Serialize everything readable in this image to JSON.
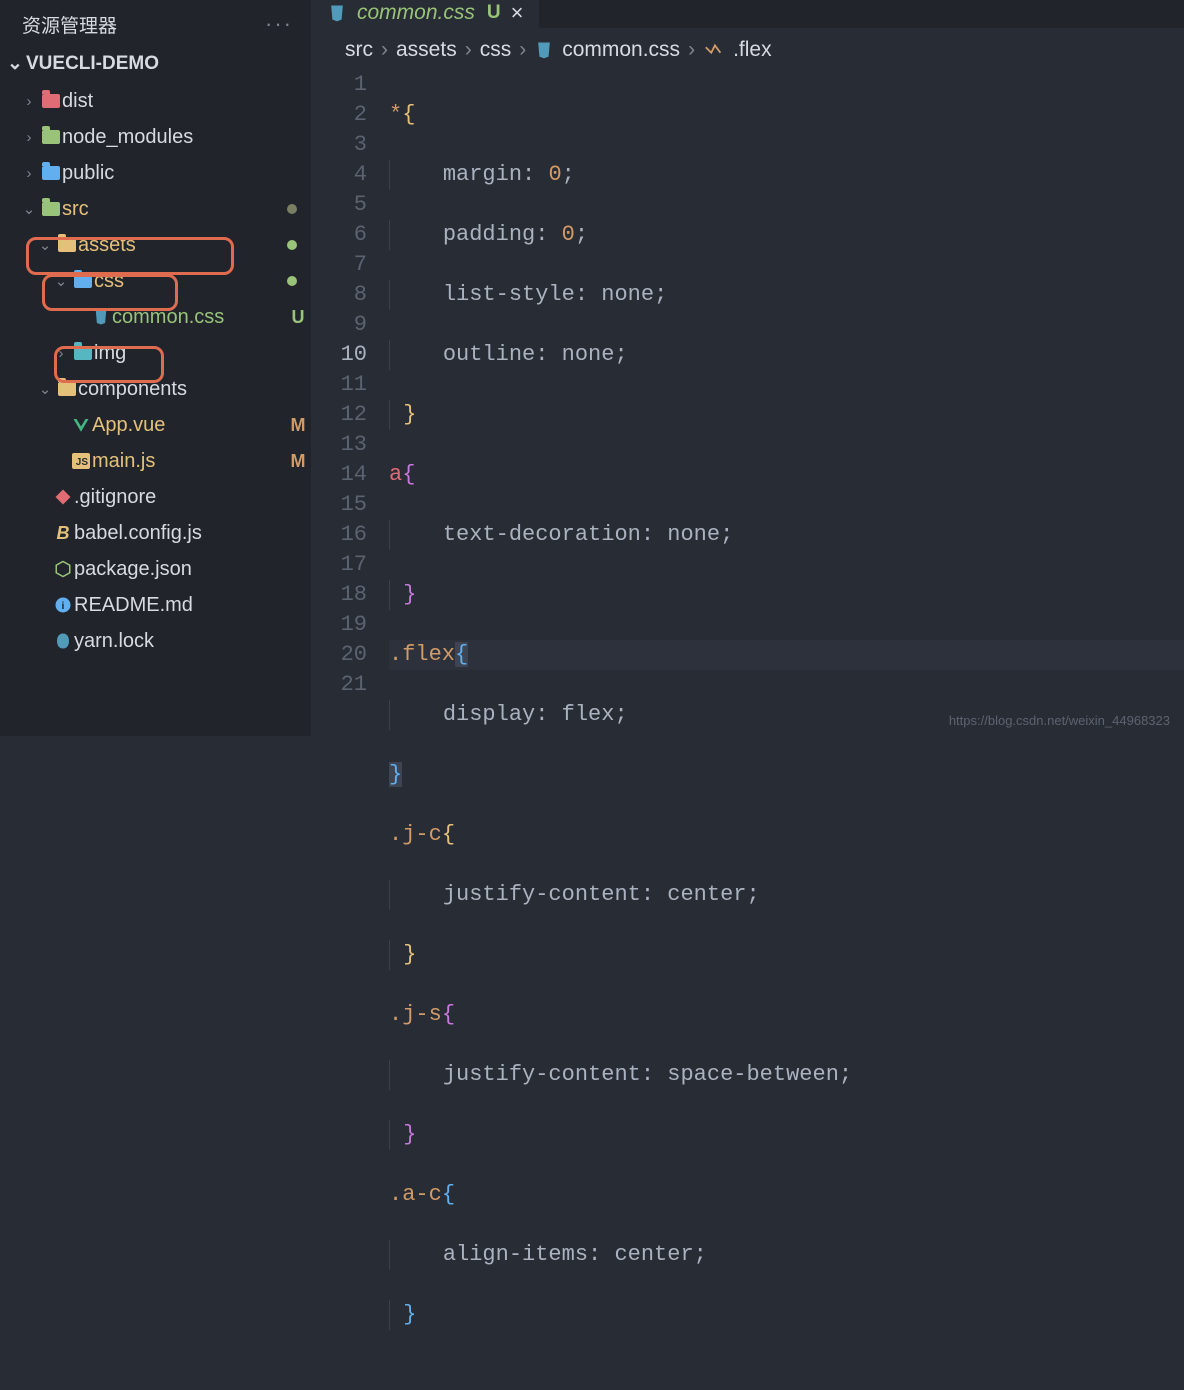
{
  "explorer": {
    "title": "资源管理器"
  },
  "project": {
    "name": "VUECLI-DEMO"
  },
  "tree": {
    "dist": "dist",
    "node_modules": "node_modules",
    "public": "public",
    "src": "src",
    "assets": "assets",
    "css": "css",
    "common_css": "common.css",
    "img": "img",
    "components": "components",
    "app_vue": "App.vue",
    "main_js": "main.js",
    "gitignore": ".gitignore",
    "babel": "babel.config.js",
    "package": "package.json",
    "readme": "README.md",
    "yarnlock": "yarn.lock"
  },
  "tab": {
    "name": "common.css",
    "status": "U"
  },
  "breadcrumbs": {
    "p1": "src",
    "p2": "assets",
    "p3": "css",
    "p4": "common.css",
    "p5": ".flex"
  },
  "code": {
    "l1a": "*",
    "l1b": "{",
    "l2a": "margin",
    "l2b": "0",
    "l3a": "padding",
    "l3b": "0",
    "l4a": "list-style",
    "l4b": "none",
    "l5a": "outline",
    "l5b": "none",
    "l6": "}",
    "l7a": "a",
    "l7b": "{",
    "l8a": "text-decoration",
    "l8b": "none",
    "l9": "}",
    "l10a": ".flex",
    "l10b": "{",
    "l11a": "display",
    "l11b": "flex",
    "l12": "}",
    "l13a": ".j-c",
    "l13b": "{",
    "l14a": "justify-content",
    "l14b": "center",
    "l15": "}",
    "l16a": ".j-s",
    "l16b": "{",
    "l17a": "justify-content",
    "l17b": "space-between",
    "l18": "}",
    "l19a": ".a-c",
    "l19b": "{",
    "l20a": "align-items",
    "l20b": "center",
    "l21": "}"
  },
  "watermark": "https://blog.csdn.net/weixin_44968323"
}
